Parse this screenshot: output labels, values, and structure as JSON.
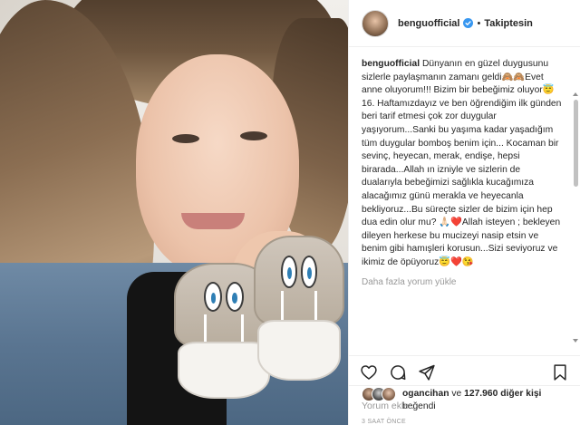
{
  "post": {
    "username": "benguofficial",
    "follow_status": "Takiptesin",
    "separator": "•",
    "caption_user": "benguofficial",
    "caption_text": " Dünyanın en güzel duygusunu sizlerle paylaşmanın zamanı geldi🙈🙈Evet anne oluyorum!!! Bizim bir bebeğimiz oluyor😇16. Haftamızdayız ve ben öğrendiğim ilk günden beri tarif etmesi çok zor duygular yaşıyorum...Sanki bu yaşıma kadar yaşadığım tüm duygular bomboş benim için... Kocaman bir sevinç, heyecan, merak, endişe, hepsi birarada...Allah ın izniyle ve sizlerin de dualarıyla bebeğimizi sağlıkla kucağımıza alacağımız günü merakla ve heyecanla bekliyoruz...Bu süreçte sizler de bizim için hep dua edin olur mu? 🙏🏻❤️Allah isteyen ; bekleyen dileyen herkese bu mucizeyi nasip etsin ve benim gibi hamışleri korusun...Sizi seviyoruz ve ikimiz de öpüyoruz😇❤️😘",
    "more_comments": "Daha fazla yorum yükle",
    "likes_user": "ogancihan",
    "likes_mid": " ve ",
    "likes_count": "127.960 diğer kişi",
    "likes_end": " beğendi",
    "time_ago": "3 SAAT ÖNCE",
    "comment_placeholder": "Yorum ekle..."
  },
  "icons": {
    "verified": "verified-badge-icon",
    "heart": "heart-icon",
    "comment": "comment-icon",
    "share": "share-icon",
    "save": "bookmark-icon"
  },
  "colors": {
    "text": "#262626",
    "muted": "#999999",
    "verified": "#3897f0",
    "border": "#efefef"
  }
}
